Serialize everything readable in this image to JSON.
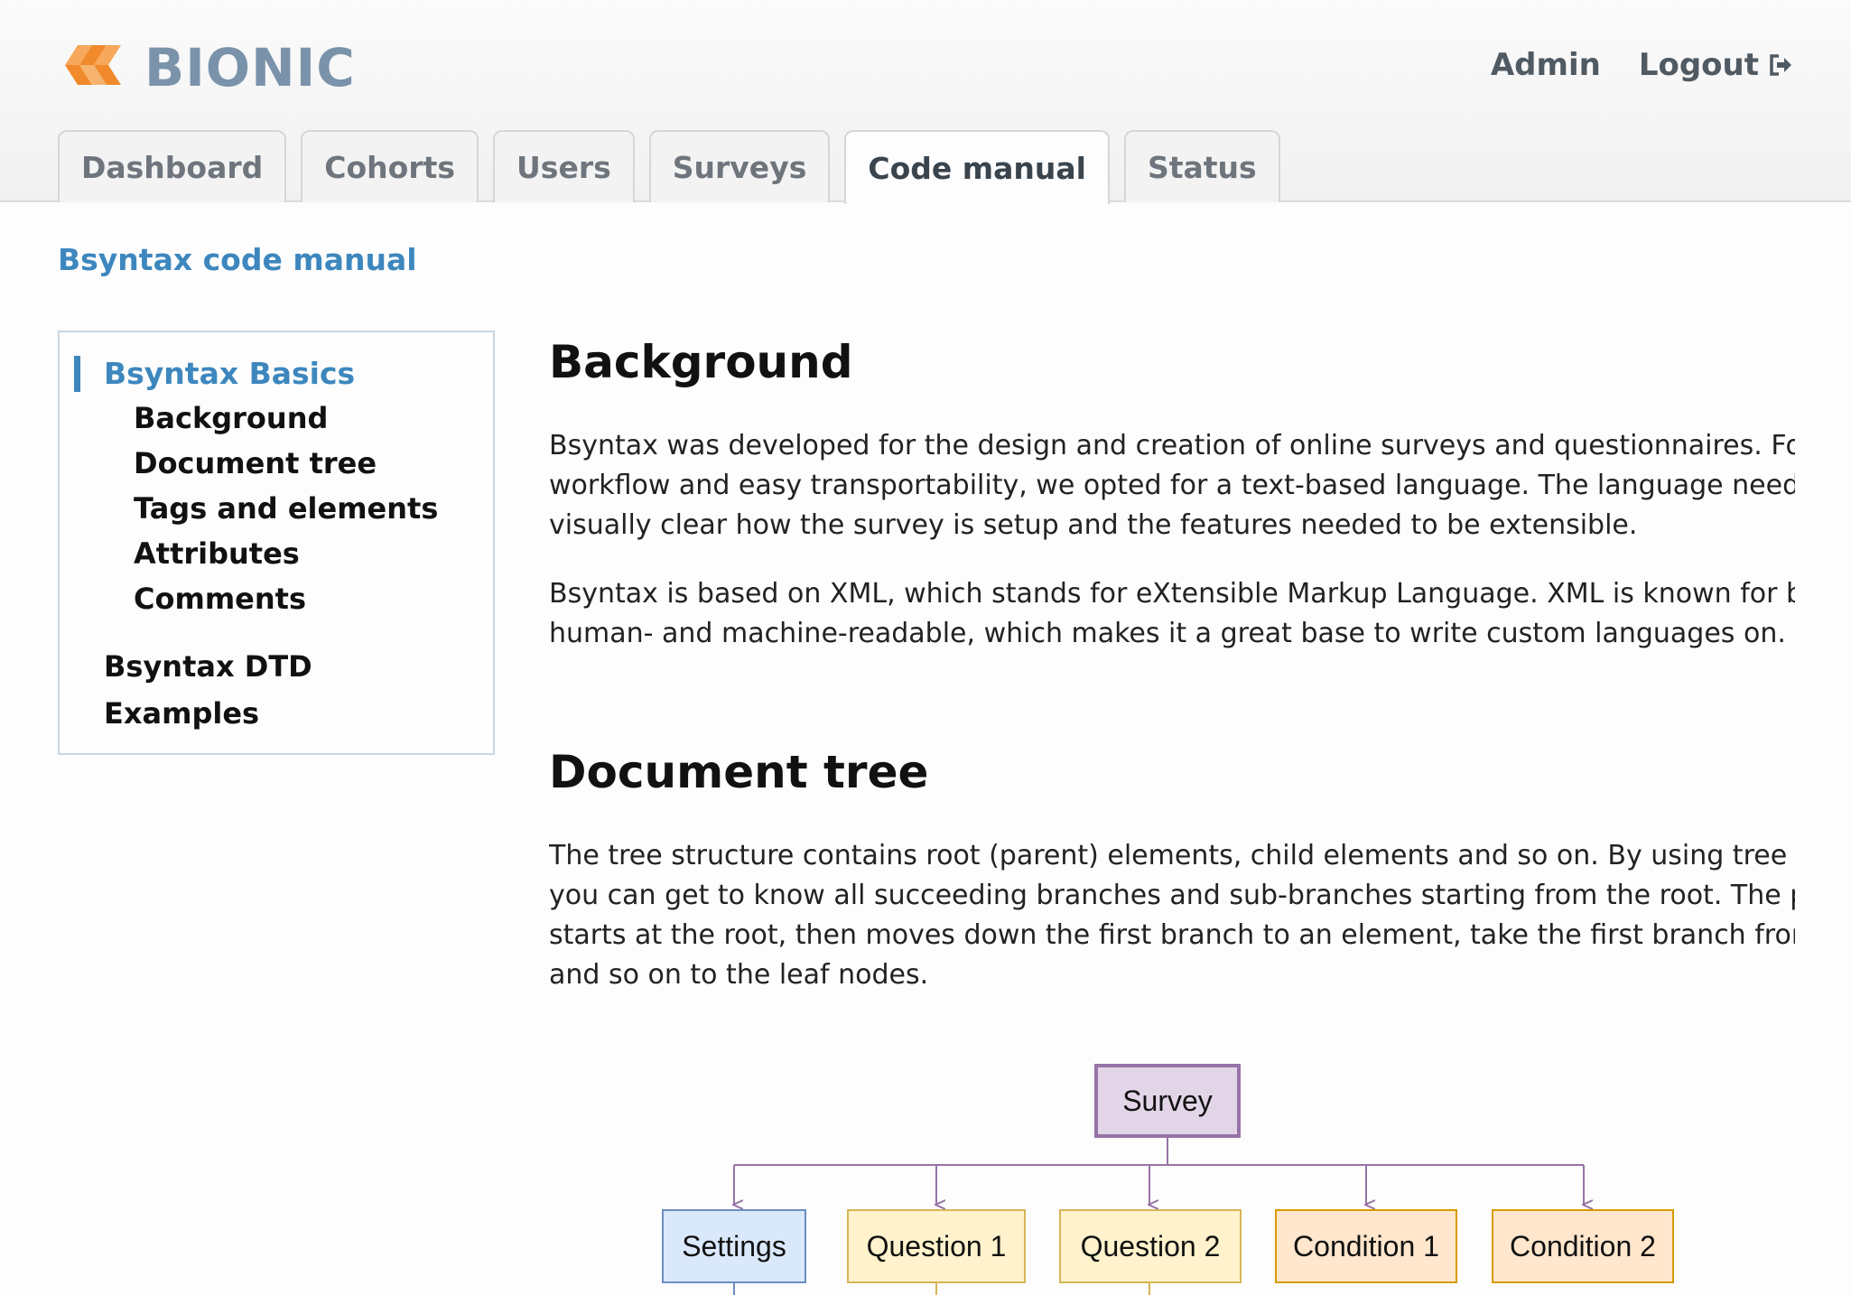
{
  "app": {
    "name": "BIONIC"
  },
  "topnav": {
    "admin": "Admin",
    "logout": "Logout"
  },
  "tabs": [
    {
      "label": "Dashboard"
    },
    {
      "label": "Cohorts"
    },
    {
      "label": "Users"
    },
    {
      "label": "Surveys"
    },
    {
      "label": "Code manual",
      "active": true
    },
    {
      "label": "Status"
    }
  ],
  "page_title": "Bsyntax code manual",
  "sidebar": {
    "section": "Bsyntax Basics",
    "items": [
      "Background",
      "Document tree",
      "Tags and elements",
      "Attributes",
      "Comments"
    ],
    "other": [
      "Bsyntax DTD",
      "Examples"
    ]
  },
  "sections": {
    "background": {
      "heading": "Background",
      "p1": [
        "Bsyntax was developed for the design and creation of online surveys and questionnaires. For",
        "workflow and easy transportability, we opted for a text-based language. The language neede",
        "visually clear how the survey is setup and the features needed to be extensible."
      ],
      "p2": [
        "Bsyntax is based on XML, which stands for eXtensible Markup Language. XML is known for be",
        "human- and machine-readable, which makes it a great base to write custom languages on."
      ]
    },
    "document_tree": {
      "heading": "Document tree",
      "p1": [
        "The tree structure contains root (parent) elements, child elements and so on. By using tree st",
        "you can get to know all succeeding branches and sub-branches starting from the root. The pa",
        "starts at the root, then moves down the first branch to an element, take the first branch from",
        "and so on to the leaf nodes."
      ]
    }
  },
  "tree": {
    "root": "Survey",
    "children": [
      "Settings",
      "Question 1",
      "Question 2",
      "Condition 1",
      "Condition 2"
    ]
  },
  "colors": {
    "accent": "#3d87be",
    "root_fill": "#e1d5e7",
    "root_border": "#9673a6",
    "settings_fill": "#dae8fc",
    "settings_border": "#6c8ebf",
    "question_fill": "#fff2cc",
    "question_border": "#d6b656",
    "condition_fill": "#ffe6cc",
    "condition_border": "#d79b00"
  }
}
